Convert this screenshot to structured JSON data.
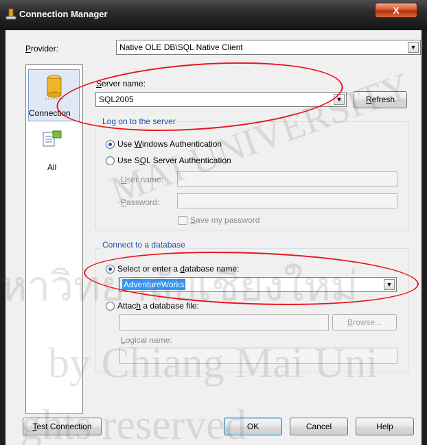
{
  "window": {
    "title": "Connection Manager",
    "close_glyph": "X"
  },
  "provider": {
    "label": "Provider:",
    "value": "Native OLE DB\\SQL Native Client"
  },
  "nav": {
    "items": [
      {
        "label": "Connection",
        "icon": "database-cylinder-icon",
        "selected": true
      },
      {
        "label": "All",
        "icon": "properties-icon",
        "selected": false
      }
    ]
  },
  "server": {
    "label": "Server name:",
    "value": "SQL2005",
    "refresh_label": "Refresh"
  },
  "logon": {
    "group_title": "Log on to the server",
    "windows_auth_label": "Use Windows Authentication",
    "sql_auth_label": "Use SQL Server Authentication",
    "selected": "windows",
    "user_name_label": "User name:",
    "user_name_value": "",
    "password_label": "Password:",
    "password_value": "",
    "save_password_label": "Save my password"
  },
  "database": {
    "group_title": "Connect to a database",
    "select_label": "Select or enter a database name:",
    "selected_value": "AdventureWorks",
    "attach_label": "Attach a database file:",
    "attach_value": "",
    "browse_label": "Browse...",
    "logical_name_label": "Logical name:",
    "logical_name_value": "",
    "selected": "select"
  },
  "footer": {
    "test_label": "Test Connection",
    "ok_label": "OK",
    "cancel_label": "Cancel",
    "help_label": "Help"
  },
  "watermark": {
    "line1": "MAI UNIVERSITY",
    "line2": "หาวิทยาลัยเชียงใหม่",
    "line3": "by Chiang Mai Uni",
    "line4": "ghts reserved"
  },
  "colors": {
    "annotation": "#e8141b",
    "group_title": "#1f4ea8",
    "selection": "#3399ff"
  }
}
